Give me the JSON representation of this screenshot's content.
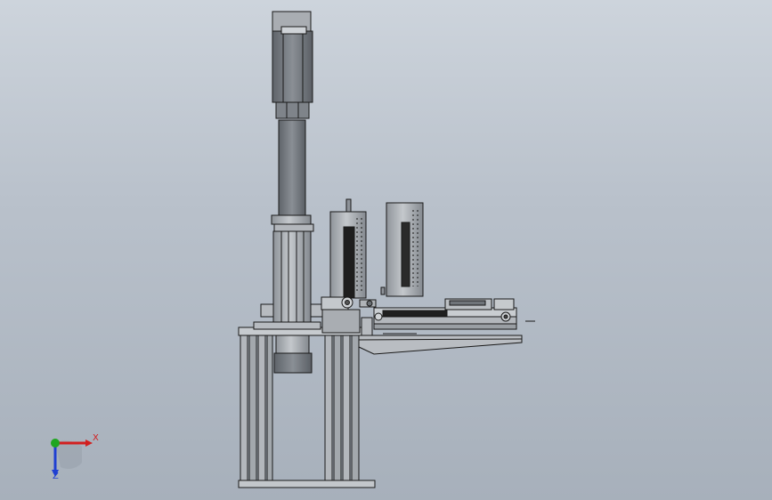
{
  "viewport": {
    "background_top": "#cdd4dc",
    "background_bottom": "#a7b0bb"
  },
  "triad": {
    "x_label": "X",
    "z_label": "Z",
    "x_color": "#d21f1f",
    "y_color": "#1fa61f",
    "z_color": "#1f3fd2"
  },
  "model": {
    "parts": [
      "servo-motor",
      "motor-coupling-housing",
      "vertical-column",
      "lower-cylinder",
      "support-frame",
      "feed-cylinder-left",
      "feed-cylinder-right",
      "linear-slide-rail",
      "clamp-block",
      "angled-bracket",
      "base-plate"
    ],
    "fill_color": "#9ea3a8",
    "edge_color": "#1a1a1a"
  }
}
